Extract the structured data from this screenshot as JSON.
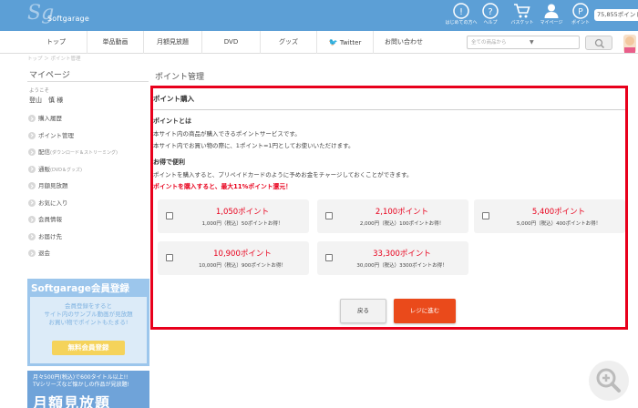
{
  "header": {
    "logo_text": "Softgarage",
    "icons": [
      {
        "name": "guide-icon",
        "label": "はじめての方へ"
      },
      {
        "name": "help-icon",
        "label": "ヘルプ"
      },
      {
        "name": "cart-icon",
        "label": "バスケット"
      },
      {
        "name": "user-icon",
        "label": "マイページ"
      },
      {
        "name": "points-icon",
        "label": "ポイント"
      }
    ],
    "points_balance": "75,855ポイント"
  },
  "nav": {
    "items": [
      "トップ",
      "単品動画",
      "月額見放題",
      "DVD",
      "グッズ",
      "Twitter",
      "お問い合わせ"
    ],
    "search_placeholder": "全ての商品から",
    "search_dropdown": "▼"
  },
  "breadcrumb": "トップ ＞ ポイント管理",
  "sidebar": {
    "title": "マイページ",
    "welcome": "ようこそ",
    "username": "登山　慎 様",
    "menu": [
      {
        "label": "購入履歴",
        "sub": ""
      },
      {
        "label": "ポイント管理",
        "sub": ""
      },
      {
        "label": "配信",
        "sub": "(ダウンロード＆ストリーミング)"
      },
      {
        "label": "通販",
        "sub": "(DVD＆グッズ)"
      },
      {
        "label": "月額見放題",
        "sub": ""
      },
      {
        "label": "お気に入り",
        "sub": ""
      },
      {
        "label": "会員情報",
        "sub": ""
      },
      {
        "label": "お届け先",
        "sub": ""
      },
      {
        "label": "退会",
        "sub": ""
      }
    ],
    "banner1": {
      "title": "Softgarage会員登録",
      "text": "会員登録をすると\nサイト内のサンプル動画が見放題\nお買い物でポイントもたまる!",
      "button": "無料会員登録"
    },
    "banner2": {
      "text": "月々500円(税込)で600タイトル以上!!\nTVシリーズなど懐かしの作品が見放題!",
      "big": "月額見放題"
    }
  },
  "main": {
    "page_title": "ポイント管理",
    "panel_title": "ポイント購入",
    "about_heading": "ポイントとは",
    "about_line1": "本サイト内の商品が購入できるポイントサービスです。",
    "about_line2": "本サイト内でお買い物の際に、1ポイント=1円としてお使いいただけます。",
    "deal_heading": "お得で便利",
    "deal_line": "ポイントを購入すると、プリペイドカードのように予めお金をチャージしておくことができます。",
    "promo": "ポイントを購入すると、最大11%ポイント還元！",
    "options": [
      {
        "points": "1,050ポイント",
        "price": "1,000円（税込）50ポイントお得！"
      },
      {
        "points": "2,100ポイント",
        "price": "2,000円（税込）100ポイントお得！"
      },
      {
        "points": "5,400ポイント",
        "price": "5,000円（税込）400ポイントお得！"
      },
      {
        "points": "10,900ポイント",
        "price": "10,000円（税込）900ポイントお得！"
      },
      {
        "points": "33,300ポイント",
        "price": "30,000円（税込）3300ポイントお得！"
      }
    ],
    "back_label": "戻る",
    "checkout_label": "レジに進む"
  },
  "colors": {
    "header_bg": "#5c9fd6",
    "highlight_border": "#e8001c",
    "points_text": "#e8001c",
    "checkout_button": "#ea4a1b"
  }
}
